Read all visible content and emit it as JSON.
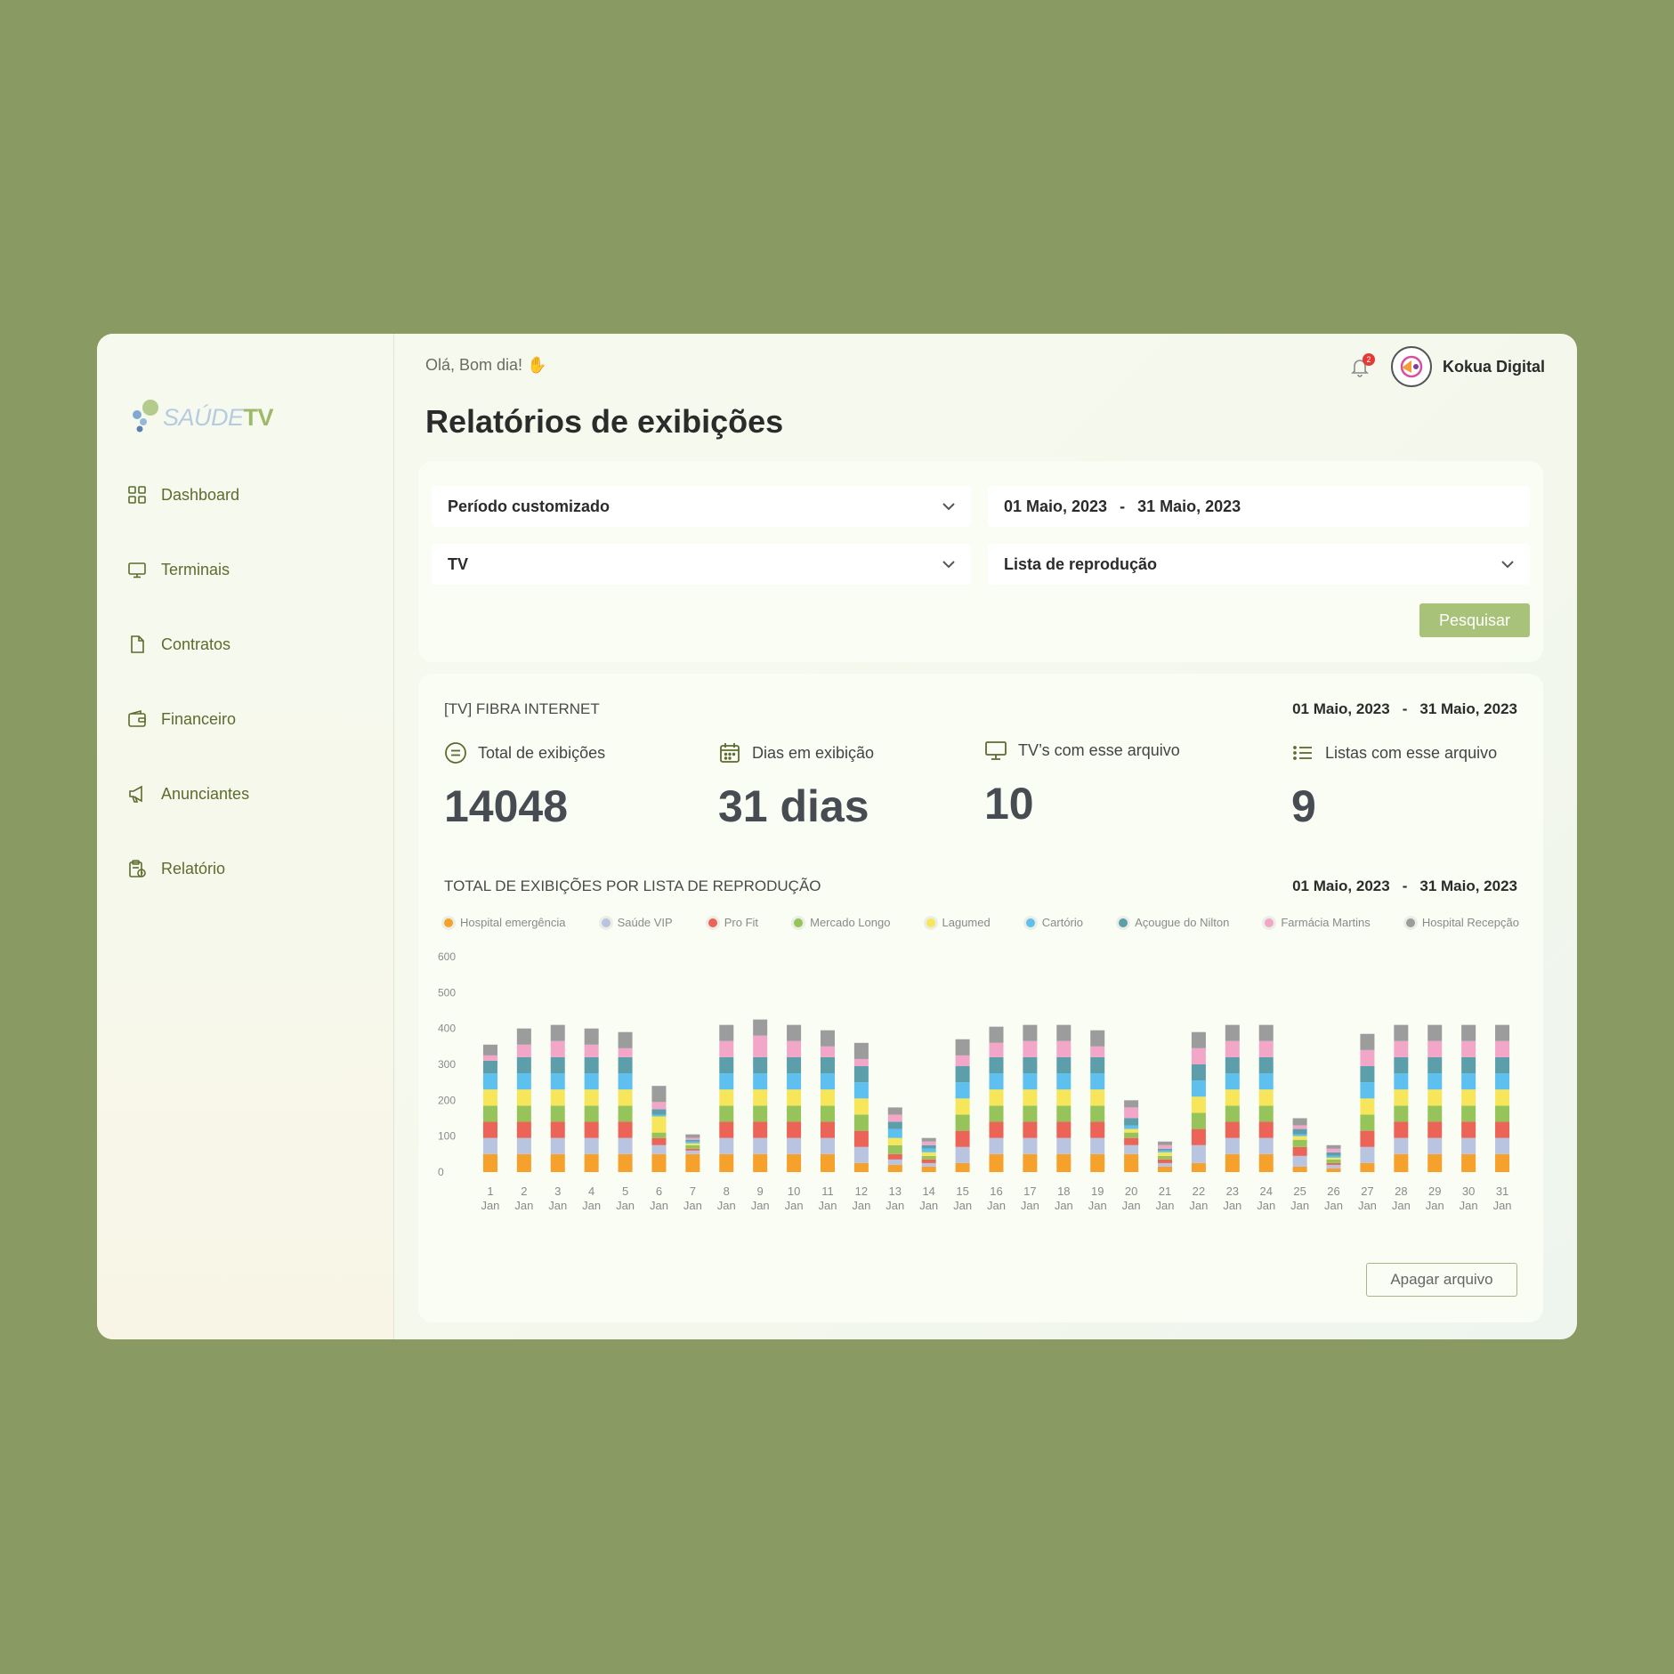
{
  "brand": {
    "logo_part1": "SAÚDE",
    "logo_part2": "TV"
  },
  "sidebar": {
    "items": [
      {
        "label": "Dashboard",
        "icon": "grid-icon"
      },
      {
        "label": "Terminais",
        "icon": "monitor-icon"
      },
      {
        "label": "Contratos",
        "icon": "document-icon"
      },
      {
        "label": "Financeiro",
        "icon": "wallet-icon"
      },
      {
        "label": "Anunciantes",
        "icon": "megaphone-icon"
      },
      {
        "label": "Relatório",
        "icon": "clipboard-icon"
      }
    ]
  },
  "header": {
    "greeting": "Olá, Bom dia!",
    "greeting_emoji": "✋",
    "notification_count": "2",
    "username": "Kokua Digital",
    "page_title": "Relatórios de exibições"
  },
  "filters": {
    "period": "Período customizado",
    "date_start": "01 Maio, 2023",
    "date_sep": "-",
    "date_end": "31 Maio, 2023",
    "terminal": "TV",
    "playlist": "Lista de reprodução",
    "search_label": "Pesquisar"
  },
  "report": {
    "title": "[TV] FIBRA INTERNET",
    "date_start": "01 Maio, 2023",
    "date_sep": "-",
    "date_end": "31 Maio, 2023",
    "stats": [
      {
        "label": "Total de exibições",
        "value": "14048",
        "icon": "equals-circle-icon"
      },
      {
        "label": "Dias em exibição",
        "value": "31 dias",
        "icon": "calendar-icon"
      },
      {
        "label": "TV’s com esse arquivo",
        "value": "10",
        "icon": "monitor-icon"
      },
      {
        "label": "Listas com esse arquivo",
        "value": "9",
        "icon": "list-icon"
      }
    ],
    "chart_title": "TOTAL DE EXIBIÇÕES POR LISTA DE REPRODUÇÃO",
    "delete_label": "Apagar arquivo"
  },
  "colors": {
    "accent": "#a8c27a",
    "background": "#8a9a63",
    "nav_text": "#5d6b2f"
  },
  "chart_data": {
    "type": "bar",
    "stacked": true,
    "grid": false,
    "legend_position": "top",
    "ylim": [
      0,
      600
    ],
    "yticks": [
      0,
      100,
      200,
      300,
      400,
      500,
      600
    ],
    "categories": [
      "1",
      "2",
      "3",
      "4",
      "5",
      "6",
      "7",
      "8",
      "9",
      "10",
      "11",
      "12",
      "13",
      "14",
      "15",
      "16",
      "17",
      "18",
      "19",
      "20",
      "21",
      "22",
      "23",
      "24",
      "25",
      "26",
      "27",
      "28",
      "29",
      "30",
      "31"
    ],
    "category_sublabel": "Jan",
    "series": [
      {
        "name": "Hospital emergência",
        "color": "#f5a12c",
        "values": [
          50,
          50,
          50,
          50,
          50,
          50,
          50,
          50,
          50,
          50,
          50,
          25,
          20,
          15,
          25,
          50,
          50,
          50,
          50,
          50,
          15,
          25,
          50,
          50,
          15,
          10,
          25,
          50,
          50,
          50,
          50
        ]
      },
      {
        "name": "Saúde VIP",
        "color": "#b8c4e0",
        "values": [
          45,
          45,
          45,
          45,
          45,
          25,
          10,
          45,
          45,
          45,
          45,
          45,
          15,
          10,
          45,
          45,
          45,
          45,
          45,
          25,
          10,
          50,
          45,
          45,
          30,
          10,
          45,
          45,
          45,
          45,
          45
        ]
      },
      {
        "name": "Pro Fit",
        "color": "#ec6357",
        "values": [
          45,
          45,
          45,
          45,
          45,
          20,
          5,
          45,
          45,
          45,
          45,
          45,
          15,
          10,
          45,
          45,
          45,
          45,
          45,
          20,
          10,
          45,
          45,
          45,
          25,
          5,
          45,
          45,
          45,
          45,
          45
        ]
      },
      {
        "name": "Mercado Longo",
        "color": "#97c45a",
        "values": [
          45,
          45,
          45,
          45,
          45,
          15,
          10,
          45,
          45,
          45,
          45,
          45,
          25,
          10,
          45,
          45,
          45,
          45,
          45,
          15,
          10,
          45,
          45,
          45,
          20,
          10,
          45,
          45,
          45,
          45,
          45
        ]
      },
      {
        "name": "Lagumed",
        "color": "#f7e65a",
        "values": [
          45,
          45,
          45,
          45,
          45,
          45,
          5,
          45,
          45,
          45,
          45,
          45,
          20,
          10,
          45,
          45,
          45,
          45,
          45,
          10,
          10,
          45,
          45,
          45,
          10,
          5,
          45,
          45,
          45,
          45,
          45
        ]
      },
      {
        "name": "Cartório",
        "color": "#5dc0ee",
        "values": [
          45,
          45,
          45,
          45,
          45,
          5,
          5,
          45,
          45,
          45,
          45,
          45,
          25,
          10,
          45,
          45,
          45,
          45,
          45,
          10,
          5,
          45,
          45,
          45,
          5,
          5,
          45,
          45,
          45,
          45,
          45
        ]
      },
      {
        "name": "Açougue do Nilton",
        "color": "#5c9faa",
        "values": [
          35,
          45,
          45,
          45,
          45,
          15,
          5,
          45,
          45,
          45,
          45,
          45,
          20,
          10,
          45,
          45,
          45,
          45,
          45,
          20,
          5,
          45,
          45,
          45,
          15,
          10,
          45,
          45,
          45,
          45,
          45
        ]
      },
      {
        "name": "Farmácia Martins",
        "color": "#f2a7c9",
        "values": [
          15,
          35,
          45,
          35,
          25,
          20,
          5,
          45,
          60,
          45,
          30,
          20,
          20,
          10,
          30,
          40,
          45,
          45,
          30,
          30,
          10,
          45,
          45,
          45,
          10,
          10,
          45,
          45,
          45,
          45,
          45
        ]
      },
      {
        "name": "Hospital Recepção",
        "color": "#9c9c9c",
        "values": [
          30,
          45,
          45,
          45,
          45,
          45,
          10,
          45,
          45,
          45,
          45,
          45,
          20,
          10,
          45,
          45,
          45,
          45,
          45,
          20,
          10,
          45,
          45,
          45,
          20,
          10,
          45,
          45,
          45,
          45,
          45
        ]
      }
    ]
  }
}
